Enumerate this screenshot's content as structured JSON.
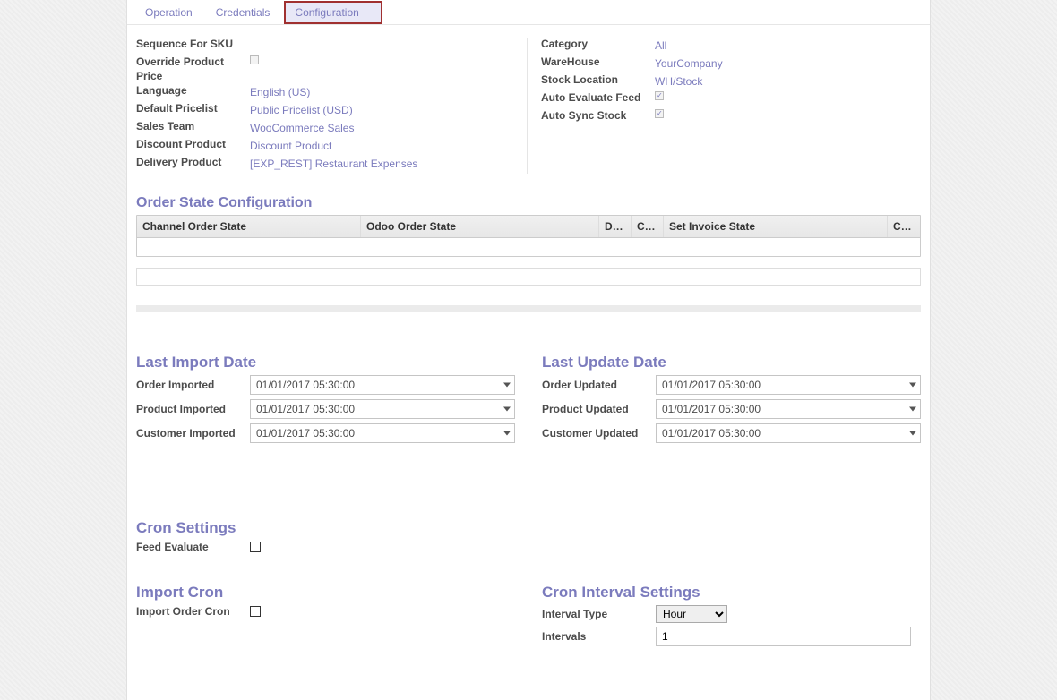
{
  "tabs": {
    "operation": "Operation",
    "credentials": "Credentials",
    "configuration": "Configuration"
  },
  "left_fields": {
    "sequence_sku": "Sequence For SKU",
    "override_price": "Override Product Price",
    "language": "Language",
    "language_val": "English (US)",
    "pricelist": "Default Pricelist",
    "pricelist_val": "Public Pricelist (USD)",
    "sales_team": "Sales Team",
    "sales_team_val": "WooCommerce Sales",
    "discount_product": "Discount Product",
    "discount_product_val": "Discount Product",
    "delivery_product": "Delivery Product",
    "delivery_product_val": "[EXP_REST] Restaurant Expenses"
  },
  "right_fields": {
    "category": "Category",
    "category_val": "All",
    "warehouse": "WareHouse",
    "warehouse_val": "YourCompany",
    "stock_location": "Stock Location",
    "stock_location_val": "WH/Stock",
    "auto_eval": "Auto Evaluate Feed",
    "auto_sync": "Auto Sync Stock"
  },
  "order_state_heading": "Order State Configuration",
  "table": {
    "c1": "Channel Order State",
    "c2": "Odoo Order State",
    "c3": "Defa…",
    "c4": "Cre…",
    "c5": "Set Invoice State",
    "c6": "Cre…"
  },
  "last_import_heading": "Last Import Date",
  "last_update_heading": "Last Update Date",
  "import": {
    "order_lbl": "Order Imported",
    "product_lbl": "Product Imported",
    "customer_lbl": "Customer Imported",
    "order_val": "01/01/2017 05:30:00",
    "product_val": "01/01/2017 05:30:00",
    "customer_val": "01/01/2017 05:30:00"
  },
  "update": {
    "order_lbl": "Order Updated",
    "product_lbl": "Product Updated",
    "customer_lbl": "Customer Updated",
    "order_val": "01/01/2017 05:30:00",
    "product_val": "01/01/2017 05:30:00",
    "customer_val": "01/01/2017 05:30:00"
  },
  "cron_settings_heading": "Cron Settings",
  "feed_evaluate": "Feed Evaluate",
  "import_cron_heading": "Import Cron",
  "import_order_cron": "Import Order Cron",
  "cron_interval_heading": "Cron Interval Settings",
  "interval_type": "Interval Type",
  "interval_type_val": "Hour",
  "intervals": "Intervals",
  "intervals_val": "1"
}
